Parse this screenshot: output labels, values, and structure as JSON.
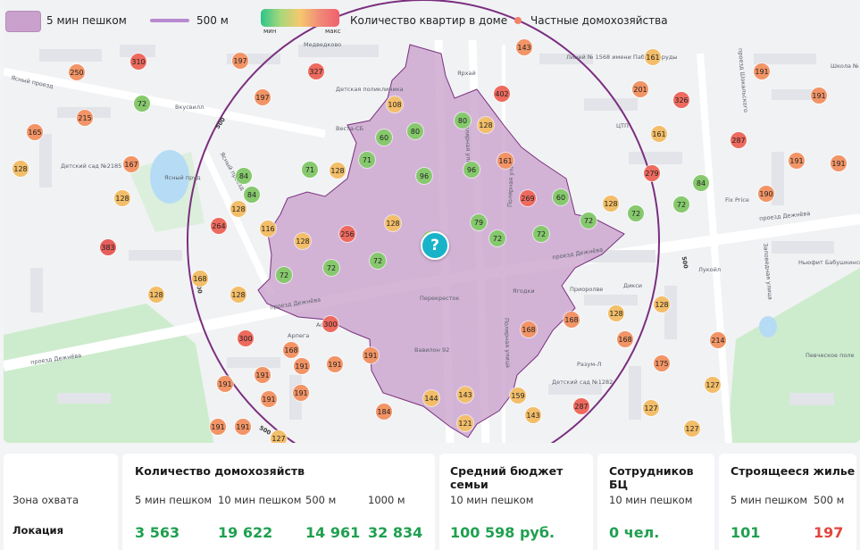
{
  "legend": {
    "walk": "5 мин пешком",
    "radius": "500 м",
    "grad_min": "мин",
    "grad_max": "макс",
    "apartments": "Количество квартир в доме",
    "private": "Частные домохозяйства"
  },
  "colors": {
    "walk_fill": "#c9a1cc",
    "circle": "#8a3d8f",
    "green": "#20a050",
    "red": "#e0463e",
    "pin": "#18b3c9"
  },
  "location_icon": "question-icon",
  "pin_label": "?",
  "map": {
    "streets": [
      "Ясный проезд",
      "Ясный проезд",
      "проезд Дежнёва",
      "проезд Дежнёва",
      "проезд Дежнёва",
      "проезд Дежнёва",
      "Полярная улица",
      "Полярная улица",
      "Полярная улица",
      "проезд Шокальского",
      "Заповедная улица"
    ],
    "pois": [
      "Ясный пруд",
      "Детский сад №2185",
      "Вкусвилл",
      "Детская поликлиника",
      "Веста-СБ",
      "Ярхай",
      "Лицей № 1568 имени Пабло Неруды",
      "ЦТП",
      "Школа №",
      "Fix Price",
      "Лукойл",
      "Ньюфит Бабушкинская",
      "Певческое поле",
      "Детский сад №1282",
      "Разум-Л",
      "Вавилон 92",
      "Перекресток",
      "Ягодки",
      "Приоролве",
      "Дикси",
      "Арпега",
      "Аска",
      "Медведково"
    ],
    "ring_label": "500",
    "markers": [
      {
        "v": "250",
        "c": "o"
      },
      {
        "v": "310",
        "c": "r"
      },
      {
        "v": "197",
        "c": "o"
      },
      {
        "v": "327",
        "c": "r"
      },
      {
        "v": "143",
        "c": "o"
      },
      {
        "v": "161",
        "c": "y"
      },
      {
        "v": "191",
        "c": "o"
      },
      {
        "v": "72",
        "c": "g"
      },
      {
        "v": "215",
        "c": "o"
      },
      {
        "v": "197",
        "c": "o"
      },
      {
        "v": "108",
        "c": "y"
      },
      {
        "v": "402",
        "c": "r"
      },
      {
        "v": "201",
        "c": "o"
      },
      {
        "v": "326",
        "c": "r"
      },
      {
        "v": "191",
        "c": "o"
      },
      {
        "v": "165",
        "c": "o"
      },
      {
        "v": "60",
        "c": "g"
      },
      {
        "v": "80",
        "c": "g"
      },
      {
        "v": "80",
        "c": "g"
      },
      {
        "v": "128",
        "c": "y"
      },
      {
        "v": "161",
        "c": "y"
      },
      {
        "v": "287",
        "c": "r"
      },
      {
        "v": "128",
        "c": "y"
      },
      {
        "v": "167",
        "c": "o"
      },
      {
        "v": "71",
        "c": "g"
      },
      {
        "v": "71",
        "c": "g"
      },
      {
        "v": "128",
        "c": "y"
      },
      {
        "v": "96",
        "c": "g"
      },
      {
        "v": "96",
        "c": "g"
      },
      {
        "v": "161",
        "c": "o"
      },
      {
        "v": "279",
        "c": "r"
      },
      {
        "v": "191",
        "c": "o"
      },
      {
        "v": "191",
        "c": "o"
      },
      {
        "v": "84",
        "c": "g"
      },
      {
        "v": "128",
        "c": "y"
      },
      {
        "v": "84",
        "c": "g"
      },
      {
        "v": "84",
        "c": "g"
      },
      {
        "v": "269",
        "c": "r"
      },
      {
        "v": "60",
        "c": "g"
      },
      {
        "v": "72",
        "c": "g"
      },
      {
        "v": "190",
        "c": "o"
      },
      {
        "v": "128",
        "c": "y"
      },
      {
        "v": "128",
        "c": "y"
      },
      {
        "v": "128",
        "c": "y"
      },
      {
        "v": "72",
        "c": "g"
      },
      {
        "v": "72",
        "c": "g"
      },
      {
        "v": "264",
        "c": "r"
      },
      {
        "v": "116",
        "c": "y"
      },
      {
        "v": "128",
        "c": "y"
      },
      {
        "v": "256",
        "c": "r"
      },
      {
        "v": "79",
        "c": "g"
      },
      {
        "v": "72",
        "c": "g"
      },
      {
        "v": "72",
        "c": "g"
      },
      {
        "v": "383",
        "c": "rr"
      },
      {
        "v": "72",
        "c": "g"
      },
      {
        "v": "72",
        "c": "g"
      },
      {
        "v": "72",
        "c": "g"
      },
      {
        "v": "128",
        "c": "y"
      },
      {
        "v": "168",
        "c": "y"
      },
      {
        "v": "128",
        "c": "y"
      },
      {
        "v": "128",
        "c": "y"
      },
      {
        "v": "168",
        "c": "o"
      },
      {
        "v": "128",
        "c": "y"
      },
      {
        "v": "300",
        "c": "r"
      },
      {
        "v": "168",
        "c": "o"
      },
      {
        "v": "168",
        "c": "o"
      },
      {
        "v": "214",
        "c": "o"
      },
      {
        "v": "300",
        "c": "r"
      },
      {
        "v": "191",
        "c": "o"
      },
      {
        "v": "168",
        "c": "o"
      },
      {
        "v": "175",
        "c": "o"
      },
      {
        "v": "191",
        "c": "o"
      },
      {
        "v": "191",
        "c": "o"
      },
      {
        "v": "191",
        "c": "o"
      },
      {
        "v": "191",
        "c": "o"
      },
      {
        "v": "191",
        "c": "o"
      },
      {
        "v": "191",
        "c": "o"
      },
      {
        "v": "191",
        "c": "o"
      },
      {
        "v": "143",
        "c": "y"
      },
      {
        "v": "159",
        "c": "y"
      },
      {
        "v": "127",
        "c": "y"
      },
      {
        "v": "144",
        "c": "y"
      },
      {
        "v": "184",
        "c": "o"
      },
      {
        "v": "287",
        "c": "r"
      },
      {
        "v": "143",
        "c": "y"
      },
      {
        "v": "191",
        "c": "o"
      },
      {
        "v": "127",
        "c": "y"
      },
      {
        "v": "121",
        "c": "y"
      },
      {
        "v": "127",
        "c": "y"
      },
      {
        "v": "127",
        "c": "y"
      }
    ]
  },
  "panels": {
    "coverage_label": "Зона охвата",
    "location_label": "Локация",
    "households": {
      "title": "Количество домохозяйств",
      "cols": [
        {
          "label": "5 мин пешком",
          "value": "3 563"
        },
        {
          "label": "10 мин пешком",
          "value": "19 622"
        },
        {
          "label": "500 м",
          "value": "14 961"
        },
        {
          "label": "1000 м",
          "value": "32 834"
        }
      ]
    },
    "budget": {
      "title": "Средний бюджет семьи",
      "label": "10 мин пешком",
      "value": "100 598 руб."
    },
    "office": {
      "title": "Сотрудников БЦ",
      "label": "10 мин пешком",
      "value": "0 чел."
    },
    "construction": {
      "title": "Строящееся жилье",
      "cols": [
        {
          "label": "5 мин пешком",
          "value": "101"
        },
        {
          "label": "500 м",
          "value": "197"
        }
      ]
    }
  }
}
